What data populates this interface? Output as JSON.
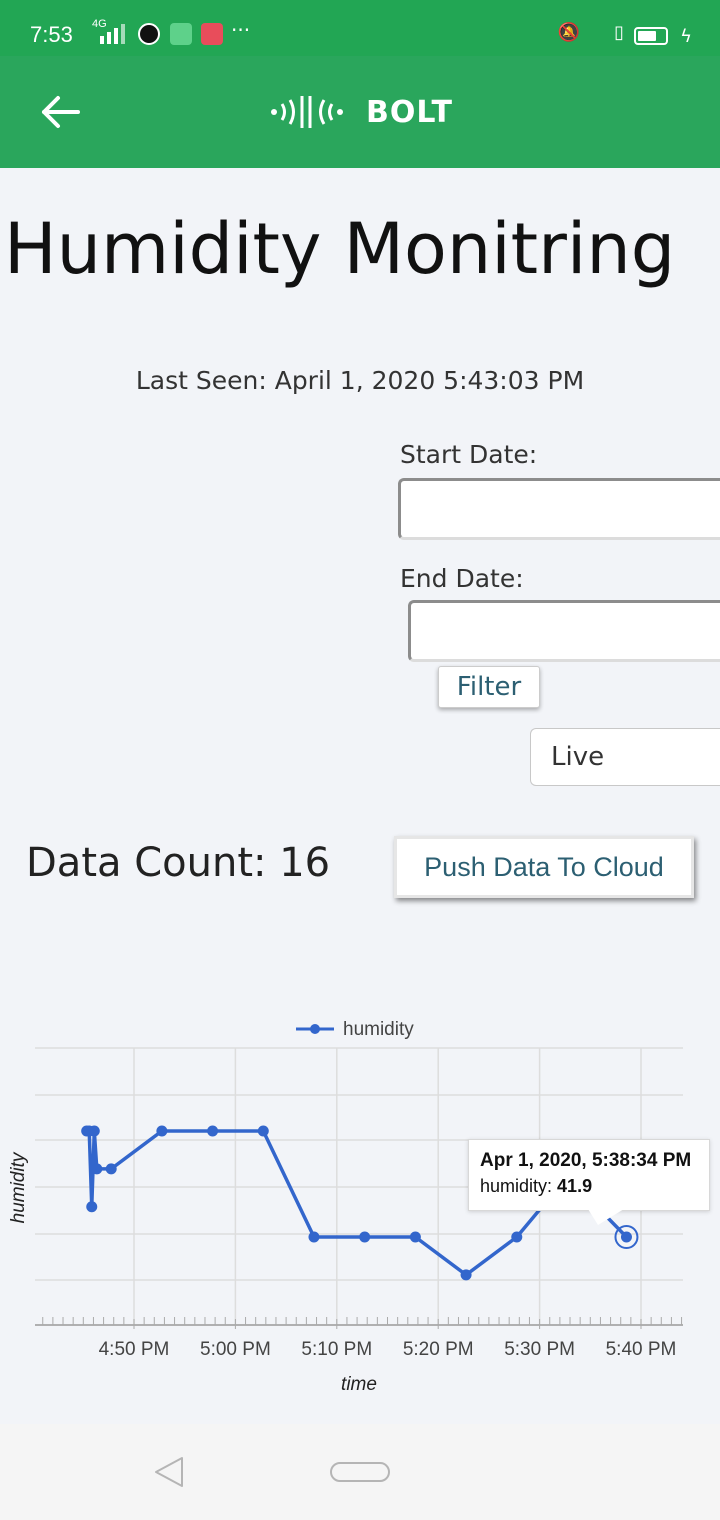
{
  "status_bar": {
    "time": "7:53",
    "network": "4G",
    "more": "···"
  },
  "app_bar": {
    "logo_text": "BOLT",
    "accent_color": "#2aa65c"
  },
  "page": {
    "title": "Humidity Monitring",
    "last_seen": "Last Seen: April 1, 2020 5:43:03 PM",
    "start_label": "Start Date:",
    "end_label": "End Date:",
    "start_value": "",
    "end_value": "",
    "filter_label": "Filter",
    "mode_selected": "Live",
    "data_count": "Data Count: 16",
    "push_label": "Push Data To Cloud"
  },
  "chart_data": {
    "type": "line",
    "xlabel": "time",
    "ylabel": "humidity",
    "legend": "top-center",
    "grid": true,
    "series": [
      {
        "name": "humidity",
        "color": "#3366cc",
        "points": [
          {
            "x": "4:45:20 PM",
            "y": 42.6
          },
          {
            "x": "4:45:35 PM",
            "y": 42.6
          },
          {
            "x": "4:45:50 PM",
            "y": 42.1
          },
          {
            "x": "4:46:05 PM",
            "y": 42.6
          },
          {
            "x": "4:46:20 PM",
            "y": 42.35
          },
          {
            "x": "4:47:45 PM",
            "y": 42.35
          },
          {
            "x": "4:52:45 PM",
            "y": 42.6
          },
          {
            "x": "4:57:45 PM",
            "y": 42.6
          },
          {
            "x": "5:02:45 PM",
            "y": 42.6
          },
          {
            "x": "5:07:45 PM",
            "y": 41.9
          },
          {
            "x": "5:12:45 PM",
            "y": 41.9
          },
          {
            "x": "5:17:45 PM",
            "y": 41.9
          },
          {
            "x": "5:22:45 PM",
            "y": 41.65
          },
          {
            "x": "5:27:45 PM",
            "y": 41.9
          },
          {
            "x": "5:32:45 PM",
            "y": 42.3
          },
          {
            "x": "5:38:34 PM",
            "y": 41.9
          }
        ]
      }
    ],
    "x_ticks": [
      "4:50 PM",
      "5:00 PM",
      "5:10 PM",
      "5:20 PM",
      "5:30 PM",
      "5:40 PM"
    ],
    "tooltip": {
      "title": "Apr 1, 2020, 5:38:34 PM",
      "series_label": "humidity:",
      "value": "41.9"
    }
  }
}
